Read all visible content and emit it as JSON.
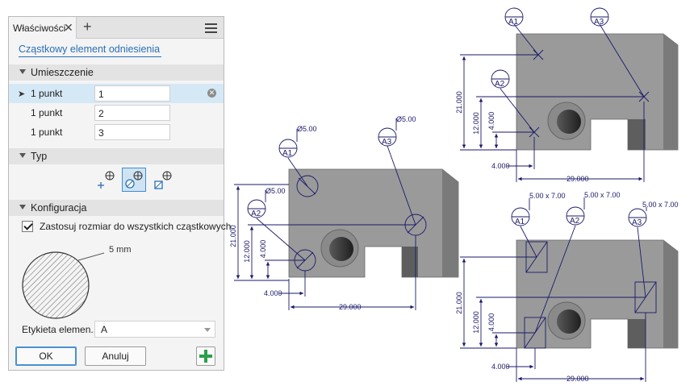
{
  "panel": {
    "tab_title": "Właściwości",
    "tab_close": "✕",
    "tab_add": "+",
    "feature_name": "Cząstkowy element odniesienia",
    "placement": {
      "title": "Umieszczenie",
      "rows": [
        {
          "label": "1 punkt",
          "value": "1"
        },
        {
          "label": "1 punkt",
          "value": "2"
        },
        {
          "label": "1 punkt",
          "value": "3"
        }
      ]
    },
    "type": {
      "title": "Typ",
      "buttons": [
        "point-target-icon",
        "circle-target-icon",
        "area-target-icon"
      ]
    },
    "config": {
      "title": "Konfiguracja",
      "apply_all_label": "Zastosuj rozmiar do wszystkich cząstkowych",
      "apply_all_checked": true,
      "preview_size": "5 mm"
    },
    "element_label": {
      "label": "Etykieta elemen...",
      "value": "A"
    },
    "buttons": {
      "ok": "OK",
      "cancel": "Anuluj"
    }
  },
  "drawings": {
    "view_circles": {
      "targets": [
        {
          "id": "A1",
          "note": "Ø5.00"
        },
        {
          "id": "A2",
          "note": "Ø5.00"
        },
        {
          "id": "A3",
          "note": "Ø5.00"
        }
      ],
      "dims": {
        "height": "21.000",
        "inner": "12.000",
        "small": "4.000",
        "offset": "4.000",
        "width": "29.000"
      }
    },
    "view_points": {
      "targets": [
        {
          "id": "A1"
        },
        {
          "id": "A2"
        },
        {
          "id": "A3"
        }
      ],
      "dims": {
        "height": "21.000",
        "inner": "12.000",
        "small": "4.000",
        "offset": "4.000",
        "width": "29.000"
      }
    },
    "view_areas": {
      "targets": [
        {
          "id": "A1",
          "note": "5.00 x 7.00"
        },
        {
          "id": "A2",
          "note": "5.00 x 7.00"
        },
        {
          "id": "A3",
          "note": "5.00 x 7.00"
        }
      ],
      "dims": {
        "height": "21.000",
        "inner": "12.000",
        "small": "4.000",
        "offset": "4.000",
        "width": "29.000"
      }
    }
  },
  "colors": {
    "accent": "#2a6fb6",
    "drawing_ink": "#1a1a6a",
    "part_gray": "#9a9a9a",
    "add_green": "#2aa04a"
  }
}
